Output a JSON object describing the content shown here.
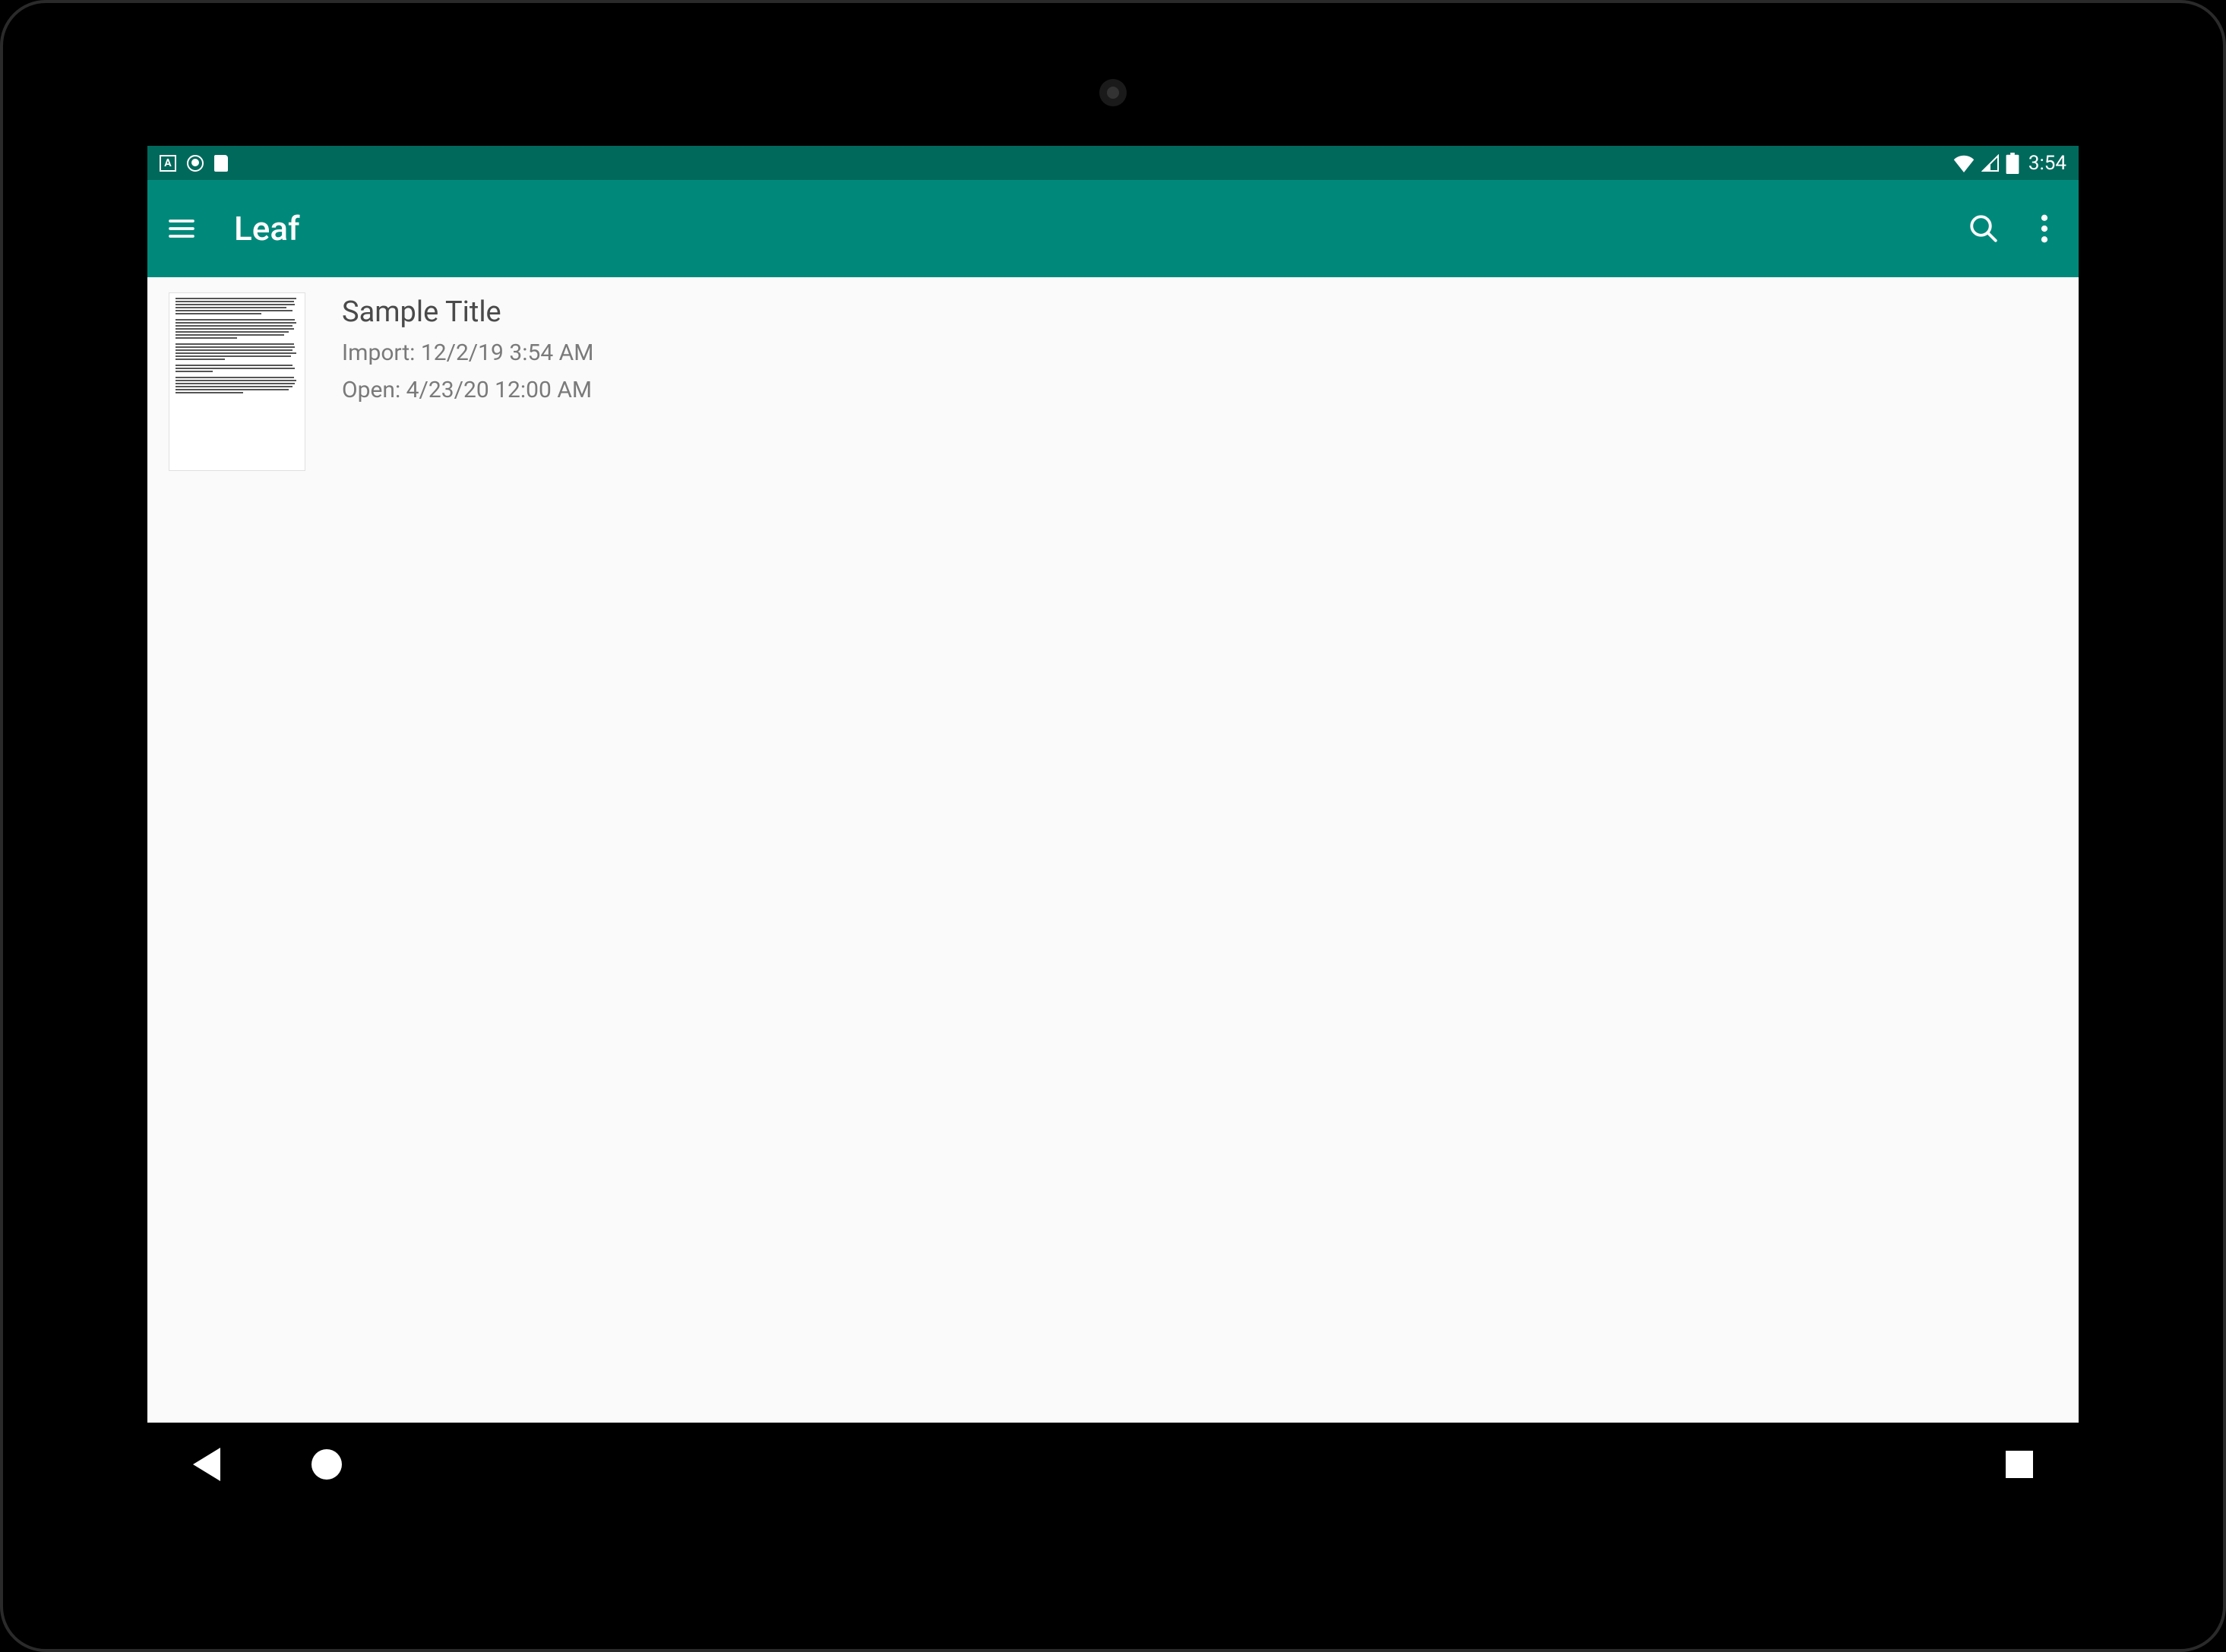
{
  "status_bar": {
    "time": "3:54"
  },
  "app_bar": {
    "title": "Leaf"
  },
  "list": {
    "items": [
      {
        "title": "Sample Title",
        "import_line": "Import: 12/2/19 3:54 AM",
        "open_line": "Open: 4/23/20 12:00 AM"
      }
    ]
  }
}
